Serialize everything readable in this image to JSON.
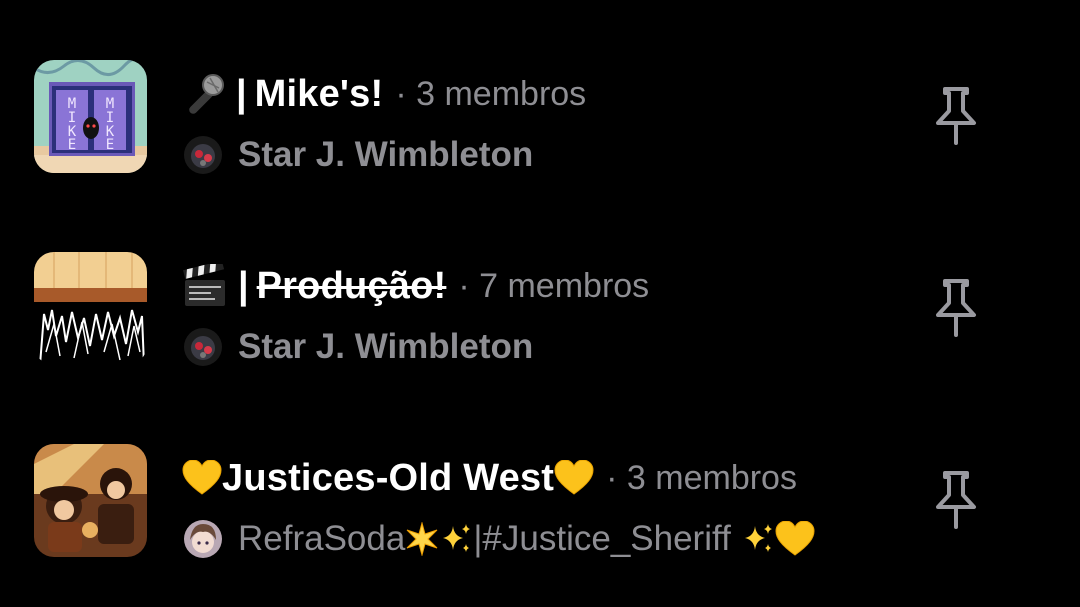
{
  "chats": [
    {
      "title": "Mike's!",
      "title_prefix_emoji": "microphone",
      "title_separator": "|",
      "member_count_text": "· 3 membros",
      "last_author": "Star J. Wimbleton",
      "thumbnail_icon": "mike-door-art",
      "pinned": true
    },
    {
      "title": "Produção!",
      "title_prefix_emoji": "clapper-board",
      "title_separator": "|",
      "title_strikethrough": true,
      "member_count_text": "· 7 membros",
      "last_author": "Star J. Wimbleton",
      "thumbnail_icon": "stage-crowd-art",
      "pinned": true
    },
    {
      "title": "Justices-Old West",
      "title_prefix_emoji": "yellow-heart",
      "title_suffix_emoji": "yellow-heart",
      "member_count_text": "· 3 membros",
      "last_author": "RefraSoda",
      "last_author_suffix": "|#Justice_Sheriff",
      "author_emojis": [
        "glowing-star",
        "sparkles",
        "sparkles",
        "yellow-heart"
      ],
      "thumbnail_icon": "old-west-art",
      "pinned": true
    }
  ],
  "colors": {
    "background": "#000000",
    "title": "#ffffff",
    "secondary": "#8e8e93",
    "pin_icon": "#9a9aa0"
  }
}
